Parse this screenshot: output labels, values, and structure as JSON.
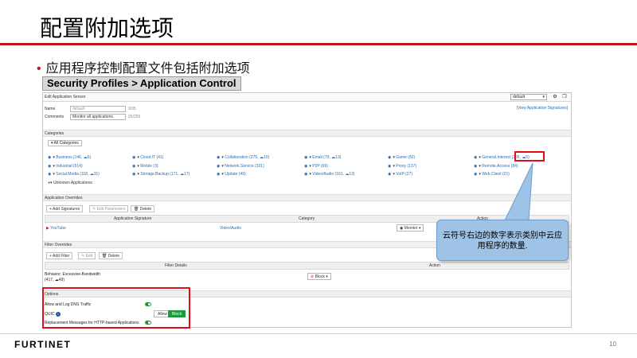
{
  "slide": {
    "title": "配置附加选项",
    "bullet": "应用程序控制配置文件包括附加选项",
    "section_banner": "Security Profiles > Application Control",
    "page_number": "10",
    "logo": "FURTINET",
    "callout_text": "云符号右边的数字表示类别中云应用程序的数量."
  },
  "panel": {
    "header_title": "Edit Application Sensor",
    "profile_select": "default",
    "view_signatures": "[View Application Signatures]",
    "name_label": "Name",
    "name_placeholder": "default",
    "name_counter": "0/35",
    "comments_label": "Comments",
    "comments_value": "Monitor all applications.",
    "comments_counter": "25/255"
  },
  "categories": {
    "label": "Categories",
    "all_label": "All Categories",
    "items": [
      {
        "label": "Business (146, ☁6)"
      },
      {
        "label": "Industrial (514)"
      },
      {
        "label": "Social.Media (118, ☁31)"
      },
      {
        "label": "Cloud.IT (41)"
      },
      {
        "label": "Mobile (3)"
      },
      {
        "label": "Storage.Backup (171, ☁17)"
      },
      {
        "label": "Collaboration (275, ☁10)"
      },
      {
        "label": "Network.Service (321)"
      },
      {
        "label": "Update (49)"
      },
      {
        "label": "Email (79, ☁13)"
      },
      {
        "label": "P2P (69)"
      },
      {
        "label": "Video/Audio (161, ☁13)"
      },
      {
        "label": "Game (82)"
      },
      {
        "label": "Proxy (137)"
      },
      {
        "label": "VoIP (27)"
      },
      {
        "label": "General.Interest (226, ☁6)"
      },
      {
        "label": "Remote.Access (84)"
      },
      {
        "label": "Web.Client (21)"
      }
    ],
    "unknown_label": "Unknown Applications",
    "highlight_value": "(226, ☁6)"
  },
  "overrides": {
    "label": "Application Overrides",
    "add_signatures": "Add Signatures",
    "edit_parameters": "Edit Parameters",
    "delete": "Delete",
    "col_signature": "Application Signature",
    "col_category": "Category",
    "col_action": "Action",
    "row_app": "YouTube",
    "row_category": "Video/Audio",
    "row_action": "Monitor"
  },
  "filters": {
    "label": "Filter Overrides",
    "add_filter": "Add Filter",
    "edit": "Edit",
    "delete": "Delete",
    "col_details": "Filter Details",
    "col_action": "Action",
    "row_details": "Behavior: Excessive-Bandwidth",
    "row_counts": "(417, ☁49)",
    "row_action": "Block"
  },
  "options": {
    "label": "Options",
    "dns": "Allow and Log DNS Traffic",
    "quic": "QUIC",
    "quic_allow": "Allow",
    "quic_block": "Block",
    "replacement": "Replacement Messages for HTTP-based Applications"
  },
  "colors": {
    "brand_red": "#c0161c",
    "callout_blue": "#9ec3e6",
    "toggle_green": "#1a9b3c",
    "highlight_red": "#e0101a"
  }
}
